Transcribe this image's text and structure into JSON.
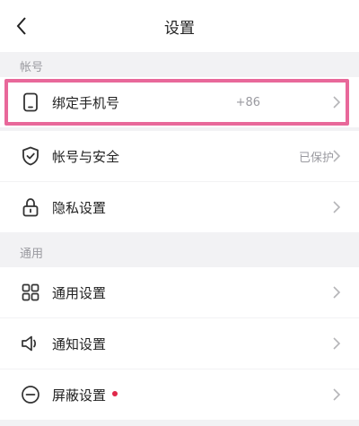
{
  "header": {
    "title": "设置"
  },
  "sections": {
    "account": "帐号",
    "general": "通用"
  },
  "rows": {
    "bind_phone": {
      "label": "绑定手机号",
      "value": "+86"
    },
    "security": {
      "label": "帐号与安全",
      "value": "已保护"
    },
    "privacy": {
      "label": "隐私设置"
    },
    "general_settings": {
      "label": "通用设置"
    },
    "notifications": {
      "label": "通知设置"
    },
    "block": {
      "label": "屏蔽设置"
    }
  },
  "colors": {
    "highlight": "#e8689a",
    "badge": "#e0284a",
    "icon": "#333333",
    "secondary_text": "#9a9aa0"
  },
  "icons": [
    "back-arrow-icon",
    "phone-icon",
    "shield-icon",
    "lock-icon",
    "grid-icon",
    "speaker-icon",
    "minus-circle-icon",
    "chevron-right-icon"
  ]
}
